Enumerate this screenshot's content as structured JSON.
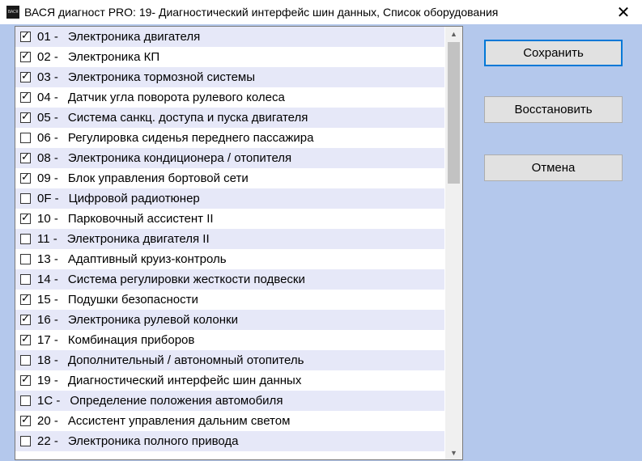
{
  "window": {
    "icon_text": "ВАСЯ",
    "title": "ВАСЯ диагност PRO: 19- Диагностический интерфейс шин данных,  Список оборудования",
    "close_glyph": "✕"
  },
  "list": {
    "items": [
      {
        "code": "01 -",
        "label": "Электроника двигателя",
        "checked": true
      },
      {
        "code": "02 -",
        "label": "Электроника КП",
        "checked": true
      },
      {
        "code": "03 -",
        "label": "Электроника тормозной системы",
        "checked": true
      },
      {
        "code": "04 -",
        "label": "Датчик угла поворота рулевого колеса",
        "checked": true
      },
      {
        "code": "05 -",
        "label": "Система санкц. доступа и пуска двигателя",
        "checked": true
      },
      {
        "code": "06 -",
        "label": "Регулировка сиденья переднего пассажира",
        "checked": false
      },
      {
        "code": "08 -",
        "label": "Электроника кондиционера / отопителя",
        "checked": true
      },
      {
        "code": "09 -",
        "label": "Блок управления бортовой сети",
        "checked": true
      },
      {
        "code": "0F -",
        "label": "Цифровой радиотюнер",
        "checked": false
      },
      {
        "code": "10 -",
        "label": "Парковочный ассистент II",
        "checked": true
      },
      {
        "code": "11 -",
        "label": "Электроника двигателя II",
        "checked": false
      },
      {
        "code": "13 -",
        "label": "Адаптивный круиз-контроль",
        "checked": false
      },
      {
        "code": "14 -",
        "label": "Система регулировки жесткости подвески",
        "checked": false
      },
      {
        "code": "15 -",
        "label": "Подушки безопасности",
        "checked": true
      },
      {
        "code": "16 -",
        "label": "Электроника рулевой колонки",
        "checked": true
      },
      {
        "code": "17 -",
        "label": "Комбинация приборов",
        "checked": true
      },
      {
        "code": "18 -",
        "label": "Дополнительный / автономный отопитель",
        "checked": false
      },
      {
        "code": "19 -",
        "label": "Диагностический интерфейс шин данных",
        "checked": true
      },
      {
        "code": "1C -",
        "label": "Определение положения автомобиля",
        "checked": false
      },
      {
        "code": "20 -",
        "label": "Ассистент управления дальним светом",
        "checked": true
      },
      {
        "code": "22 -",
        "label": "Электроника полного привода",
        "checked": false
      }
    ],
    "check_glyph": "✓"
  },
  "scrollbar": {
    "up_glyph": "▲",
    "down_glyph": "▼"
  },
  "buttons": {
    "save": "Сохранить",
    "restore": "Восстановить",
    "cancel": "Отмена"
  },
  "colors": {
    "client_bg": "#b4c8ec",
    "row_alt": "#e6e8f8",
    "default_button_border": "#0078d7"
  }
}
